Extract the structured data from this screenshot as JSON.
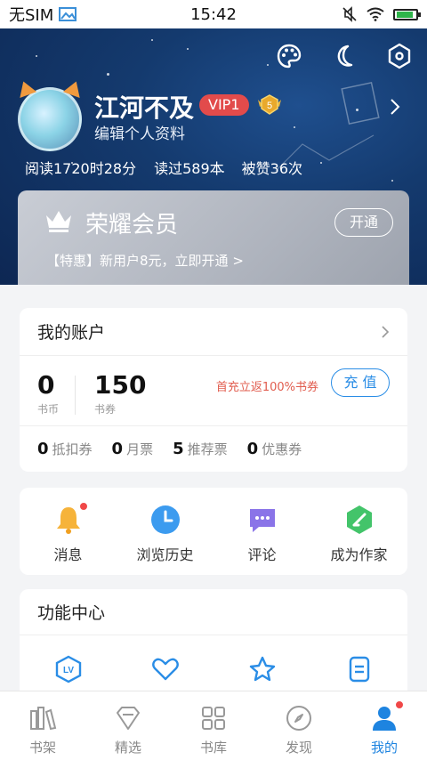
{
  "status_bar": {
    "carrier": "无SIM",
    "time": "15:42",
    "battery_level": 0.82
  },
  "profile": {
    "username": "江河不及",
    "vip_badge": "VIP1",
    "medal_number": "5",
    "edit_label": "编辑个人资料",
    "stats": {
      "reading_time": "阅读1720时28分",
      "books_read": "读过589本",
      "likes": "被赞36次"
    }
  },
  "membership": {
    "title": "荣耀会员",
    "open_label": "开通",
    "promo": "【特惠】新用户8元，立即开通 >"
  },
  "account": {
    "title": "我的账户",
    "coins": {
      "value": "0",
      "label": "书币"
    },
    "vouchers": {
      "value": "150",
      "label": "书券"
    },
    "recharge_promo": "首充立返100%书券",
    "recharge_label": "充 值",
    "tickets": [
      {
        "value": "0",
        "label": "抵扣券"
      },
      {
        "value": "0",
        "label": "月票"
      },
      {
        "value": "5",
        "label": "推荐票"
      },
      {
        "value": "0",
        "label": "优惠券"
      }
    ]
  },
  "quick_actions": [
    {
      "label": "消息",
      "icon": "bell-icon",
      "badge": true
    },
    {
      "label": "浏览历史",
      "icon": "clock-icon",
      "badge": false
    },
    {
      "label": "评论",
      "icon": "comment-icon",
      "badge": false
    },
    {
      "label": "成为作家",
      "icon": "pen-icon",
      "badge": false
    }
  ],
  "function_center": {
    "title": "功能中心",
    "icons": [
      "level-icon",
      "heart-icon",
      "star-icon",
      "document-icon"
    ]
  },
  "tabs": [
    {
      "label": "书架",
      "icon": "bookshelf-icon",
      "active": false
    },
    {
      "label": "精选",
      "icon": "diamond-icon",
      "active": false
    },
    {
      "label": "书库",
      "icon": "grid-icon",
      "active": false
    },
    {
      "label": "发现",
      "icon": "compass-icon",
      "active": false
    },
    {
      "label": "我的",
      "icon": "user-icon",
      "active": true
    }
  ],
  "colors": {
    "accent": "#1e84e0",
    "vip_red": "#e24b4b",
    "hero_dark": "#0d2753"
  }
}
